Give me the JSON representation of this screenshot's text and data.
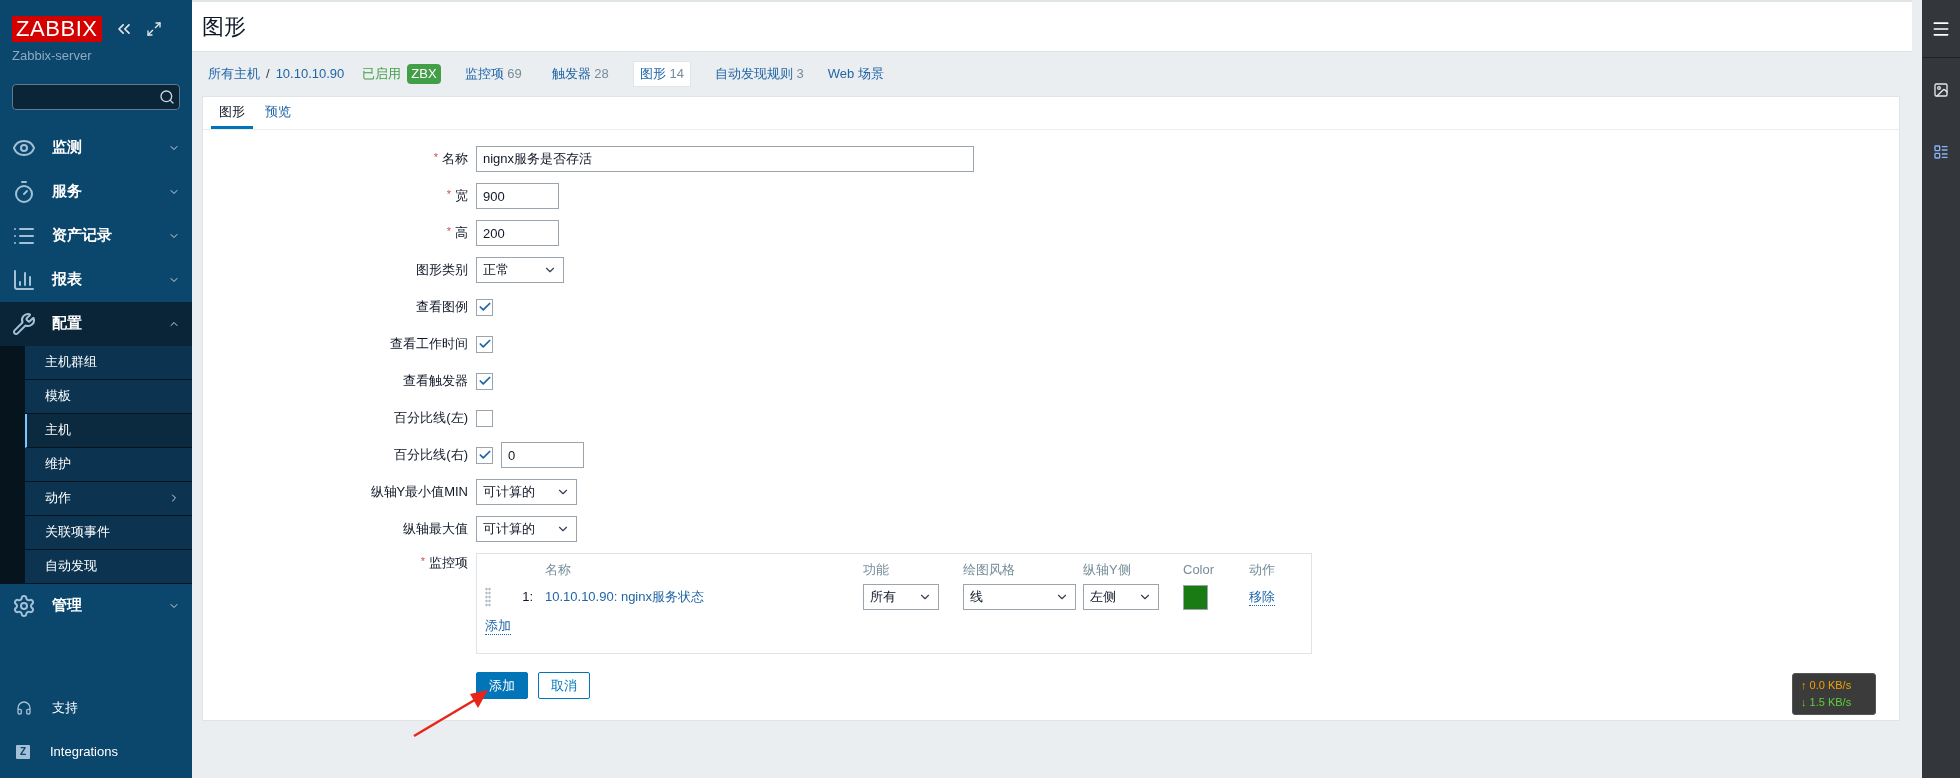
{
  "sidebar": {
    "logo": "ZABBIX",
    "server": "Zabbix-server",
    "menu": [
      {
        "label": "监测",
        "expanded": false
      },
      {
        "label": "服务",
        "expanded": false
      },
      {
        "label": "资产记录",
        "expanded": false
      },
      {
        "label": "报表",
        "expanded": false
      },
      {
        "label": "配置",
        "expanded": true,
        "children": [
          {
            "label": "主机群组",
            "selected": false,
            "submenu": false
          },
          {
            "label": "模板",
            "selected": false,
            "submenu": false
          },
          {
            "label": "主机",
            "selected": true,
            "submenu": false
          },
          {
            "label": "维护",
            "selected": false,
            "submenu": false
          },
          {
            "label": "动作",
            "selected": false,
            "submenu": true
          },
          {
            "label": "关联项事件",
            "selected": false,
            "submenu": false
          },
          {
            "label": "自动发现",
            "selected": false,
            "submenu": false
          }
        ]
      },
      {
        "label": "管理",
        "expanded": false
      }
    ],
    "footer": [
      {
        "label": "支持"
      },
      {
        "label": "Integrations",
        "badge": "Z"
      }
    ]
  },
  "page_title": "图形",
  "breadcrumbs": [
    {
      "kind": "link",
      "label": "所有主机"
    },
    {
      "kind": "sep",
      "label": "/"
    },
    {
      "kind": "link",
      "label": "10.10.10.90"
    },
    {
      "kind": "status",
      "label": "已启用"
    },
    {
      "kind": "badge",
      "label": "ZBX"
    },
    {
      "kind": "count",
      "label": "监控项",
      "count": "69",
      "selected": false
    },
    {
      "kind": "count",
      "label": "触发器",
      "count": "28",
      "selected": false
    },
    {
      "kind": "count",
      "label": "图形",
      "count": "14",
      "selected": true
    },
    {
      "kind": "count",
      "label": "自动发现规则",
      "count": "3",
      "selected": false
    },
    {
      "kind": "link",
      "label": "Web 场景"
    }
  ],
  "tabs": [
    {
      "label": "图形",
      "selected": true
    },
    {
      "label": "预览",
      "selected": false
    }
  ],
  "fields": [
    {
      "kind": "text",
      "label": "名称",
      "mark": "*",
      "value": "nignx服务是否存活"
    },
    {
      "kind": "text",
      "label": "宽",
      "mark": "*",
      "value": "900"
    },
    {
      "kind": "text",
      "label": "高",
      "mark": "*",
      "value": "200"
    },
    {
      "kind": "select",
      "label": "图形类别",
      "value": "正常"
    },
    {
      "kind": "checkbox",
      "label": "查看图例",
      "checked": true
    },
    {
      "kind": "checkbox",
      "label": "查看工作时间",
      "checked": true
    },
    {
      "kind": "checkbox",
      "label": "查看触发器",
      "checked": true
    },
    {
      "kind": "checkbox",
      "label": "百分比线(左)",
      "checked": false
    },
    {
      "kind": "checkbox_input",
      "label": "百分比线(右)",
      "checked": true,
      "value": "0"
    },
    {
      "kind": "select",
      "label": "纵轴Y最小值MIN",
      "value": "可计算的"
    },
    {
      "kind": "select",
      "label": "纵轴最大值",
      "value": "可计算的"
    }
  ],
  "items": {
    "label": "监控项",
    "mark": "*",
    "columns": [
      "名称",
      "功能",
      "绘图风格",
      "纵轴Y侧",
      "Color",
      "动作"
    ],
    "rows": [
      {
        "index": "1:",
        "name": "10.10.10.90: nginx服务状态",
        "function": "所有",
        "style": "线",
        "axis": "左侧",
        "color": "#1a7a14",
        "action": "移除"
      }
    ],
    "add_link": "添加"
  },
  "buttons": [
    {
      "label": "添加",
      "kind": "primary"
    },
    {
      "label": "取消",
      "kind": "secondary"
    }
  ],
  "speed": {
    "up": "↑ 0.0 KB/s",
    "down": "↓ 1.5 KB/s"
  }
}
